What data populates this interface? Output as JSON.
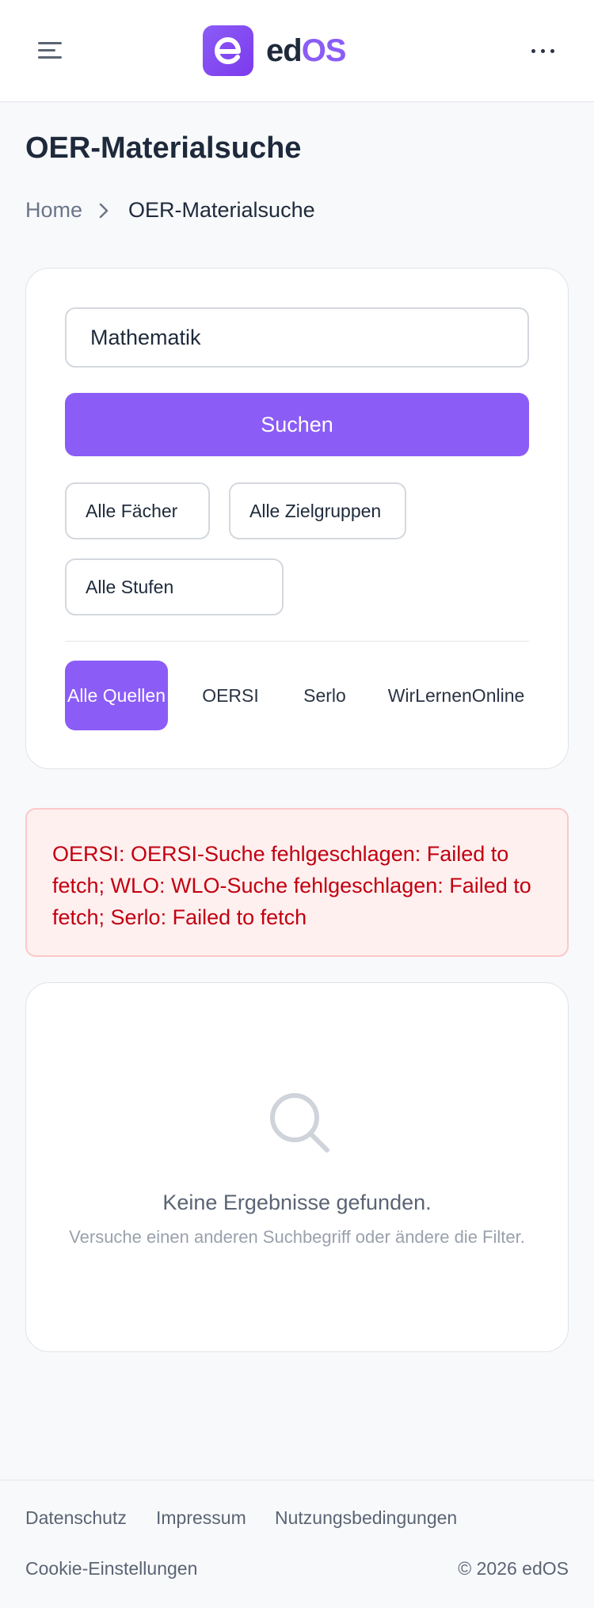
{
  "header": {
    "brand_letter": "e",
    "brand_ed": "ed",
    "brand_os": "OS",
    "menu_icon": "menu-icon",
    "more_icon": "more-horizontal-icon",
    "accent_color": "#8b5cf6"
  },
  "page": {
    "title": "OER-Materialsuche"
  },
  "breadcrumb": {
    "home": "Home",
    "current": "OER-Materialsuche",
    "separator_icon": "chevron-right-icon"
  },
  "search": {
    "query": "Mathematik",
    "button_label": "Suchen"
  },
  "filters": {
    "subject": "Alle Fächer",
    "audience": "Alle Zielgruppen",
    "level": "Alle Stufen"
  },
  "sources": {
    "tabs": [
      {
        "label": "Alle Quellen",
        "active": true
      },
      {
        "label": "OERSI",
        "active": false
      },
      {
        "label": "Serlo",
        "active": false
      },
      {
        "label": "WirLernenOnline",
        "active": false
      }
    ]
  },
  "error": {
    "message": "OERSI: OERSI-Suche fehlgeschlagen: Failed to fetch; WLO: WLO-Suche fehlgeschlagen: Failed to fetch; Serlo: Failed to fetch",
    "color": "#c20010"
  },
  "empty_state": {
    "icon": "search-icon",
    "title": "Keine Ergebnisse gefunden.",
    "subtitle": "Versuche einen anderen Suchbegriff oder ändere die Filter."
  },
  "footer": {
    "privacy": "Datenschutz",
    "imprint": "Impressum",
    "terms": "Nutzungsbedingungen",
    "cookies": "Cookie-Einstellungen",
    "copyright": "© 2026 edOS"
  }
}
